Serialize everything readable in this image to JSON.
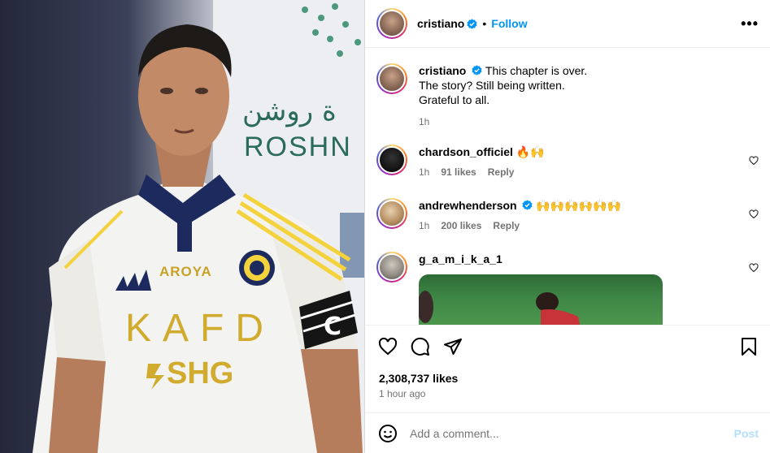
{
  "post": {
    "author": "cristiano",
    "follow_label": "Follow",
    "more_label": "•••",
    "caption_lines": [
      "This chapter is over.",
      "The story? Still being written.",
      "Grateful to all."
    ],
    "caption_time": "1h"
  },
  "media": {
    "sponsor_arabic": "ة روشن",
    "sponsor_latin": "ROSHN",
    "jersey_brand": "AROYA",
    "jersey_main": "KAFD",
    "jersey_sub": "SHG",
    "armband": "C"
  },
  "comments": [
    {
      "username": "chardson_officiel",
      "text": "🔥🙌",
      "time": "1h",
      "likes": "91 likes",
      "reply": "Reply"
    },
    {
      "username": "andrewhenderson",
      "text": "🙌🙌🙌🙌🙌🙌",
      "time": "1h",
      "likes": "200 likes",
      "reply": "Reply"
    },
    {
      "username": "g_a_m_i_k_a_1",
      "text": ""
    }
  ],
  "engagement": {
    "likes": "2,308,737 likes",
    "time": "1 hour ago"
  },
  "composer": {
    "placeholder": "Add a comment...",
    "post_label": "Post"
  },
  "colors": {
    "accent": "#0095f6",
    "verified": "#0095f6",
    "muted": "#737373",
    "post_disabled": "#b2dffc"
  },
  "icons": [
    "more-options-icon",
    "verified-badge-icon",
    "heart-icon",
    "comment-icon",
    "share-icon",
    "save-icon",
    "emoji-icon"
  ]
}
